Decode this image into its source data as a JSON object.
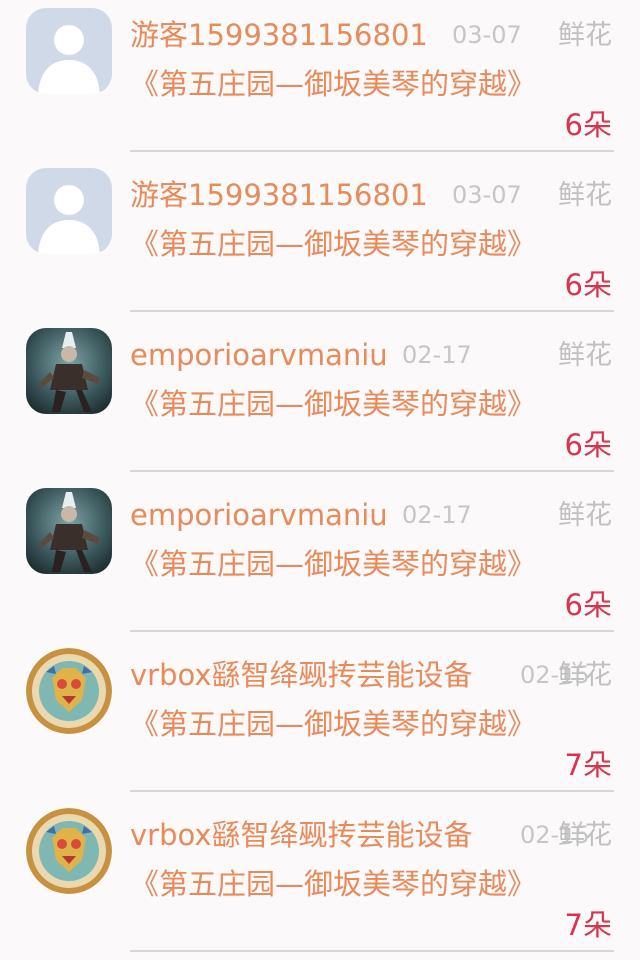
{
  "gift_list": {
    "items": [
      {
        "avatar": "default-person-avatar",
        "name": "游客1599381156801",
        "date": "03-07",
        "gift": "鲜花",
        "title": "《第五庄园—御坂美琴的穿越》",
        "count": "6朵"
      },
      {
        "avatar": "default-person-avatar",
        "name": "游客1599381156801",
        "date": "03-07",
        "gift": "鲜花",
        "title": "《第五庄园—御坂美琴的穿越》",
        "count": "6朵"
      },
      {
        "avatar": "game-character-avatar",
        "name": "emporioarvmaniu",
        "date": "02-17",
        "gift": "鲜花",
        "title": "《第五庄园—御坂美琴的穿越》",
        "count": "6朵"
      },
      {
        "avatar": "game-character-avatar",
        "name": "emporioarvmaniu",
        "date": "02-17",
        "gift": "鲜花",
        "title": "《第五庄园—御坂美琴的穿越》",
        "count": "6朵"
      },
      {
        "avatar": "illustrated-medallion-avatar",
        "name": "vrbox繇智绛觋抟芸能设备",
        "date": "02-15",
        "gift": "鲜花",
        "title": "《第五庄园—御坂美琴的穿越》",
        "count": "7朵"
      },
      {
        "avatar": "illustrated-medallion-avatar",
        "name": "vrbox繇智绛觋抟芸能设备",
        "date": "02-15",
        "gift": "鲜花",
        "title": "《第五庄园—御坂美琴的穿越》",
        "count": "7朵"
      }
    ]
  },
  "colors": {
    "background": "#fbf9f9",
    "name_text": "#e88a5a",
    "muted_text": "#c6c6c6",
    "count_text": "#d9344c",
    "divider": "#d8d6d6"
  }
}
